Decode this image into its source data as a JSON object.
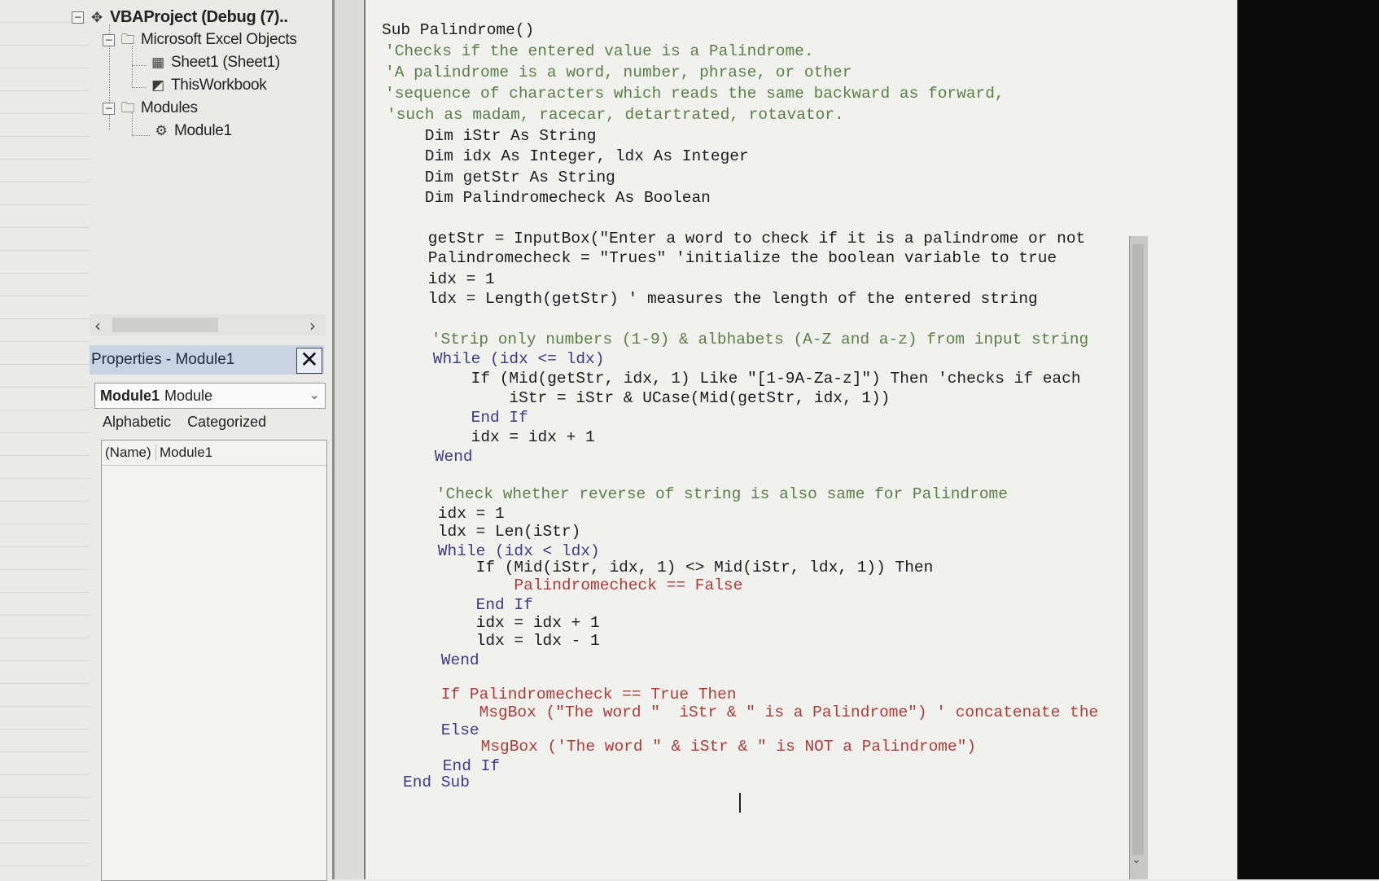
{
  "project_tree": {
    "root": {
      "label": "VBAProject (Debug (7)..",
      "icon": "vba-project-icon"
    },
    "items": [
      {
        "label": "Microsoft Excel Objects",
        "icon": "folder-icon"
      },
      {
        "label": "Sheet1 (Sheet1)",
        "icon": "sheet-icon"
      },
      {
        "label": "ThisWorkbook",
        "icon": "workbook-icon"
      },
      {
        "label": "Modules",
        "icon": "folder-icon"
      },
      {
        "label": "Module1",
        "icon": "module-icon"
      }
    ]
  },
  "properties": {
    "title": "Properties - Module1",
    "close": "✕",
    "object_name": "Module1",
    "object_type": "Module",
    "tabs": [
      "Alphabetic",
      "Categorized"
    ],
    "rows": [
      {
        "key": "(Name)",
        "value": "Module1"
      }
    ]
  },
  "code_lines": [
    {
      "text": "Sub Palindrome()",
      "style": "c-tx"
    },
    {
      "text": "'Checks if the entered value is a Palindrome.",
      "style": "c-cm"
    },
    {
      "text": "'A palindrome is a word, number, phrase, or other",
      "style": "c-cm"
    },
    {
      "text": "'sequence of characters which reads the same backward as forward,",
      "style": "c-cm"
    },
    {
      "text": "'such as madam, racecar, detartrated, rotavator.",
      "style": "c-cm"
    },
    {
      "text": "    Dim iStr As String",
      "style": "c-tx"
    },
    {
      "text": "    Dim idx As Integer, ldx As Integer",
      "style": "c-tx"
    },
    {
      "text": "    Dim getStr As String",
      "style": "c-tx"
    },
    {
      "text": "    Dim Palindromecheck As Boolean",
      "style": "c-tx"
    },
    {
      "text": "",
      "style": "c-tx"
    },
    {
      "text": "    getStr = InputBox(\"Enter a word to check if it is a palindrome or not",
      "style": "c-tx"
    },
    {
      "text": "    Palindromecheck = \"Trues\" 'initialize the boolean variable to true",
      "style": "c-tx"
    },
    {
      "text": "    idx = 1",
      "style": "c-tx"
    },
    {
      "text": "    ldx = Length(getStr) ' measures the length of the entered string",
      "style": "c-tx"
    },
    {
      "text": "",
      "style": "c-tx"
    },
    {
      "text": "    'Strip only numbers (1-9) & albhabets (A-Z and a-z) from input string",
      "style": "c-cm"
    },
    {
      "text": "    While (idx <= ldx)",
      "style": "c-kw"
    },
    {
      "text": "        If (Mid(getStr, idx, 1) Like \"[1-9A-Za-z]\") Then 'checks if each",
      "style": "c-tx"
    },
    {
      "text": "            iStr = iStr & UCase(Mid(getStr, idx, 1))",
      "style": "c-tx"
    },
    {
      "text": "        End If",
      "style": "c-kw"
    },
    {
      "text": "        idx = idx + 1",
      "style": "c-tx"
    },
    {
      "text": "    Wend",
      "style": "c-kw"
    },
    {
      "text": "",
      "style": "c-tx"
    },
    {
      "text": "    'Check whether reverse of string is also same for Palindrome",
      "style": "c-cm"
    },
    {
      "text": "    idx = 1",
      "style": "c-tx"
    },
    {
      "text": "    ldx = Len(iStr)",
      "style": "c-tx"
    },
    {
      "text": "    While (idx < ldx)",
      "style": "c-kw"
    },
    {
      "text": "        If (Mid(iStr, idx, 1) <> Mid(iStr, ldx, 1)) Then",
      "style": "c-tx"
    },
    {
      "text": "            Palindromecheck == False",
      "style": "c-er"
    },
    {
      "text": "        End If",
      "style": "c-kw"
    },
    {
      "text": "        idx = idx + 1",
      "style": "c-tx"
    },
    {
      "text": "        ldx = ldx - 1",
      "style": "c-tx"
    },
    {
      "text": "    Wend",
      "style": "c-kw"
    },
    {
      "text": "",
      "style": "c-tx"
    },
    {
      "text": "    If Palindromecheck == True Then",
      "style": "c-er"
    },
    {
      "text": "        MsgBox (\"The word \"  iStr & \" is a Palindrome\") ' concatenate the",
      "style": "c-er"
    },
    {
      "text": "    Else",
      "style": "c-kw"
    },
    {
      "text": "        MsgBox ('The word \" & iStr & \" is NOT a Palindrome\")",
      "style": "c-er"
    },
    {
      "text": "    End If",
      "style": "c-kw"
    },
    {
      "text": "End Sub",
      "style": "c-kw"
    }
  ],
  "colors": {
    "keyword": "#3b3b8a",
    "comment": "#5c7f4a",
    "error": "#b13a3a",
    "text": "#1c1c1c"
  }
}
